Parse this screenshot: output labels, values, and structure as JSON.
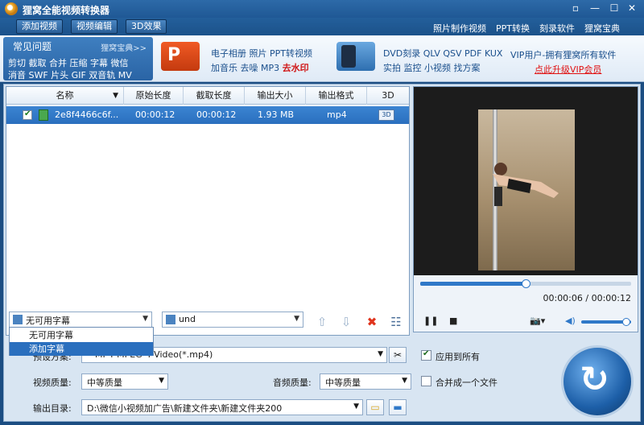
{
  "window": {
    "title": "狸窝全能视频转换器"
  },
  "toolbar": {
    "add_video": "添加视频",
    "edit_video": "视频编辑",
    "effect_3d": "3D效果",
    "links": [
      "照片制作视频",
      "PPT转换",
      "刻录软件",
      "狸窝宝典"
    ]
  },
  "banner": {
    "faq_title": "常见问题",
    "faq_more": "狸窝宝典>>",
    "faq_line1": "剪切 截取 合并 压缩 字幕 微信",
    "faq_line2": "消音 SWF 片头 GIF 双音轨 MV",
    "mid1_line1": "电子相册 照片 PPT转视频",
    "mid1_line2a": "加音乐 去噪 MP3 ",
    "mid1_line2b": "去水印",
    "mid2_line1": "DVD刻录 QLV QSV PDF KUX",
    "mid2_line2": "实拍 监控 小视频 找方案",
    "vip_text": "VIP用户-拥有狸窝所有软件",
    "vip_link": "点此升级VIP会员"
  },
  "list": {
    "columns": [
      "名称",
      "原始长度",
      "截取长度",
      "输出大小",
      "输出格式",
      "3D"
    ],
    "rows": [
      {
        "name": "2e8f4466c6f...",
        "orig_length": "00:00:12",
        "cut_length": "00:00:12",
        "size": "1.93 MB",
        "format": "mp4",
        "checked": true
      }
    ]
  },
  "player": {
    "time": "00:00:06 / 00:00:12",
    "progress": 0.5,
    "volume": 0.9
  },
  "subtitle": {
    "selected": "无可用字幕",
    "options": [
      "无可用字幕",
      "添加字幕"
    ],
    "highlighted": "添加字幕"
  },
  "audio_track": {
    "selected": "und"
  },
  "settings": {
    "preset_label": "预设方案:",
    "preset_value": "MP4-MPEG-4 Video(*.mp4)",
    "apply_all": "应用到所有",
    "video_quality_label": "视频质量:",
    "video_quality": "中等质量",
    "audio_quality_label": "音频质量:",
    "audio_quality": "中等质量",
    "merge": "合并成一个文件",
    "output_label": "输出目录:",
    "output_path": "D:\\微信小视频加广告\\新建文件夹\\新建文件夹200"
  }
}
